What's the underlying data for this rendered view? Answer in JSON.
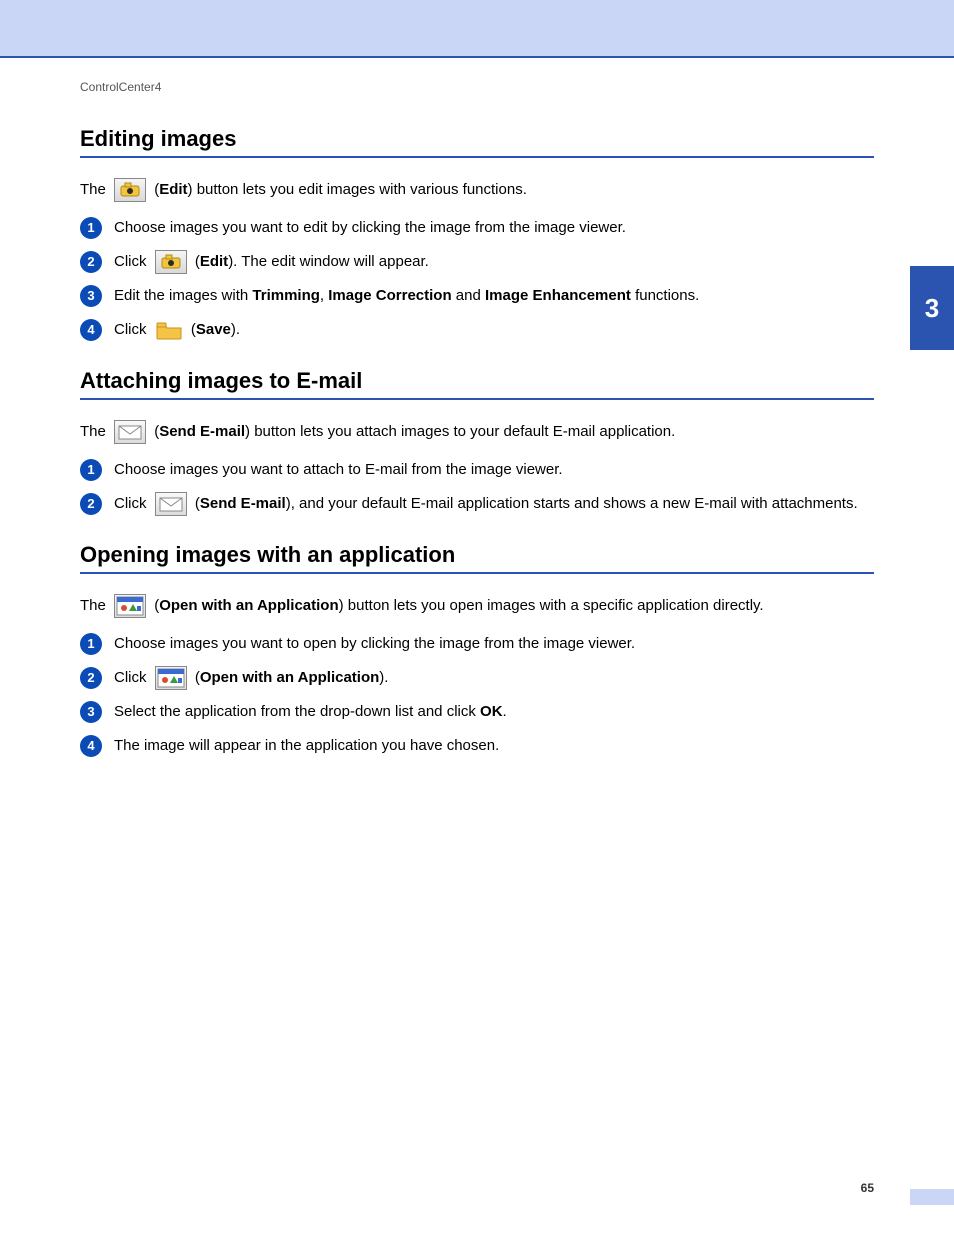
{
  "breadcrumb": "ControlCenter4",
  "chapter_tab": "3",
  "page_number": "65",
  "sections": {
    "editing": {
      "title": "Editing images",
      "intro_pre": "The ",
      "intro_label": "Edit",
      "intro_post": ") button lets you edit images with various functions.",
      "steps": {
        "s1": "Choose images you want to edit by clicking the image from the image viewer.",
        "s2_pre": "Click ",
        "s2_label": "Edit",
        "s2_post": "). The edit window will appear.",
        "s3_pre": "Edit the images with ",
        "s3_b1": "Trimming",
        "s3_sep1": ", ",
        "s3_b2": "Image Correction",
        "s3_sep2": " and ",
        "s3_b3": "Image Enhancement",
        "s3_post": " functions.",
        "s4_pre": "Click ",
        "s4_label": "Save",
        "s4_post": ")."
      }
    },
    "email": {
      "title": "Attaching images to E-mail",
      "intro_pre": "The ",
      "intro_label": "Send E-mail",
      "intro_post": ") button lets you attach images to your default E-mail application.",
      "steps": {
        "s1": "Choose images you want to attach to E-mail from the image viewer.",
        "s2_pre": "Click ",
        "s2_label": "Send E-mail",
        "s2_post": "), and your default E-mail application starts and shows a new E-mail with attachments."
      }
    },
    "openapp": {
      "title": "Opening images with an application",
      "intro_pre": "The ",
      "intro_label": "Open with an Application",
      "intro_post": ") button lets you open images with a specific application directly.",
      "steps": {
        "s1": "Choose images you want to open by clicking the image from the image viewer.",
        "s2_pre": "Click ",
        "s2_label": "Open with an Application",
        "s2_post": ").",
        "s3_pre": "Select the application from the drop-down list and click ",
        "s3_b1": "OK",
        "s3_post": ".",
        "s4": "The image will appear in the application you have chosen."
      }
    }
  }
}
